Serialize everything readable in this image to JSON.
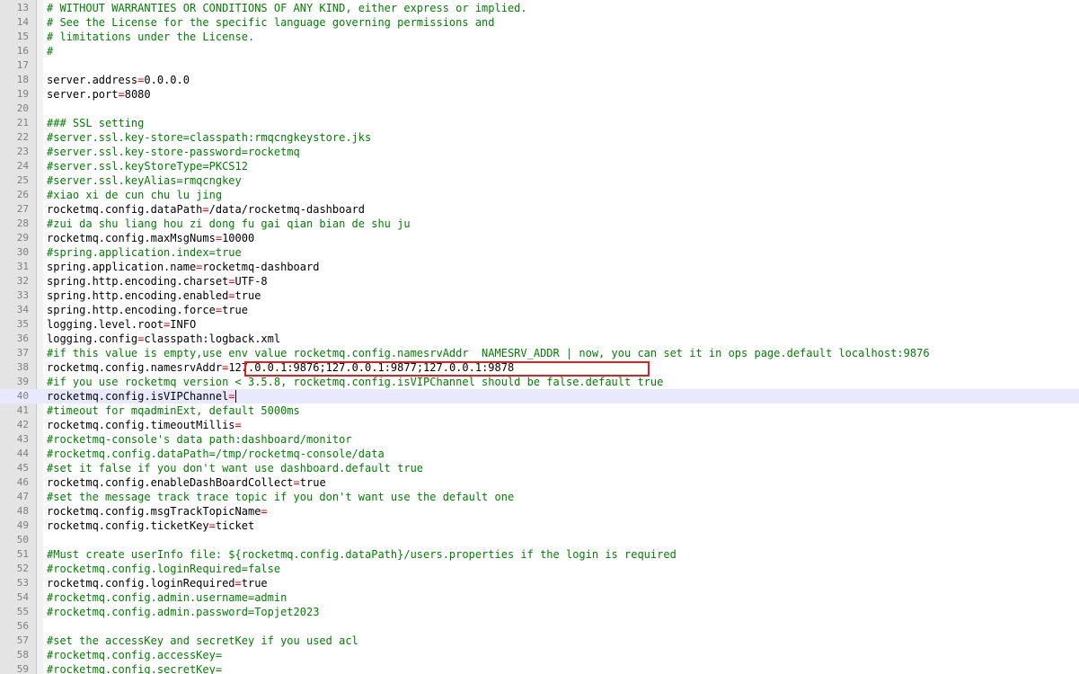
{
  "editor": {
    "current_line": 40,
    "lines": [
      {
        "n": "13",
        "type": "comment",
        "text": "# WITHOUT WARRANTIES OR CONDITIONS OF ANY KIND, either express or implied."
      },
      {
        "n": "14",
        "type": "comment",
        "text": "# See the License for the specific language governing permissions and"
      },
      {
        "n": "15",
        "type": "comment",
        "text": "# limitations under the License."
      },
      {
        "n": "16",
        "type": "comment",
        "text": "#"
      },
      {
        "n": "17",
        "type": "blank",
        "text": ""
      },
      {
        "n": "18",
        "type": "kv",
        "key": "server.address",
        "value": "0.0.0.0"
      },
      {
        "n": "19",
        "type": "kv",
        "key": "server.port",
        "value": "8080"
      },
      {
        "n": "20",
        "type": "blank",
        "text": ""
      },
      {
        "n": "21",
        "type": "comment",
        "text": "### SSL setting"
      },
      {
        "n": "22",
        "type": "comment",
        "text": "#server.ssl.key-store=classpath:rmqcngkeystore.jks"
      },
      {
        "n": "23",
        "type": "comment",
        "text": "#server.ssl.key-store-password=rocketmq"
      },
      {
        "n": "24",
        "type": "comment",
        "text": "#server.ssl.keyStoreType=PKCS12"
      },
      {
        "n": "25",
        "type": "comment",
        "text": "#server.ssl.keyAlias=rmqcngkey"
      },
      {
        "n": "26",
        "type": "comment",
        "text": "#xiao xi de cun chu lu jing"
      },
      {
        "n": "27",
        "type": "kv",
        "key": "rocketmq.config.dataPath",
        "value": "/data/rocketmq-dashboard"
      },
      {
        "n": "28",
        "type": "comment",
        "text": "#zui da shu liang hou zi dong fu gai qian bian de shu ju"
      },
      {
        "n": "29",
        "type": "kv",
        "key": "rocketmq.config.maxMsgNums",
        "value": "10000"
      },
      {
        "n": "30",
        "type": "comment",
        "text": "#spring.application.index=true"
      },
      {
        "n": "31",
        "type": "kv",
        "key": "spring.application.name",
        "value": "rocketmq-dashboard"
      },
      {
        "n": "32",
        "type": "kv",
        "key": "spring.http.encoding.charset",
        "value": "UTF-8"
      },
      {
        "n": "33",
        "type": "kv",
        "key": "spring.http.encoding.enabled",
        "value": "true"
      },
      {
        "n": "34",
        "type": "kv",
        "key": "spring.http.encoding.force",
        "value": "true"
      },
      {
        "n": "35",
        "type": "kv",
        "key": "logging.level.root",
        "value": "INFO"
      },
      {
        "n": "36",
        "type": "kv",
        "key": "logging.config",
        "value": "classpath:logback.xml"
      },
      {
        "n": "37",
        "type": "comment",
        "text": "#if this value is empty,use env value rocketmq.config.namesrvAddr  NAMESRV_ADDR | now, you can set it in ops page.default localhost:9876"
      },
      {
        "n": "38",
        "type": "kv",
        "key": "rocketmq.config.namesrvAddr",
        "value": "127.0.0.1:9876;127.0.0.1:9877;127.0.0.1:9878"
      },
      {
        "n": "39",
        "type": "comment",
        "text": "#if you use rocketmq version < 3.5.8, rocketmq.config.isVIPChannel should be false.default true"
      },
      {
        "n": "40",
        "type": "kv",
        "key": "rocketmq.config.isVIPChannel",
        "value": ""
      },
      {
        "n": "41",
        "type": "comment",
        "text": "#timeout for mqadminExt, default 5000ms"
      },
      {
        "n": "42",
        "type": "kv",
        "key": "rocketmq.config.timeoutMillis",
        "value": ""
      },
      {
        "n": "43",
        "type": "comment",
        "text": "#rocketmq-console's data path:dashboard/monitor"
      },
      {
        "n": "44",
        "type": "comment",
        "text": "#rocketmq.config.dataPath=/tmp/rocketmq-console/data"
      },
      {
        "n": "45",
        "type": "comment",
        "text": "#set it false if you don't want use dashboard.default true"
      },
      {
        "n": "46",
        "type": "kv",
        "key": "rocketmq.config.enableDashBoardCollect",
        "value": "true"
      },
      {
        "n": "47",
        "type": "comment",
        "text": "#set the message track trace topic if you don't want use the default one"
      },
      {
        "n": "48",
        "type": "kv",
        "key": "rocketmq.config.msgTrackTopicName",
        "value": ""
      },
      {
        "n": "49",
        "type": "kv",
        "key": "rocketmq.config.ticketKey",
        "value": "ticket"
      },
      {
        "n": "50",
        "type": "blank",
        "text": ""
      },
      {
        "n": "51",
        "type": "comment",
        "text": "#Must create userInfo file: ${rocketmq.config.dataPath}/users.properties if the login is required"
      },
      {
        "n": "52",
        "type": "comment",
        "text": "#rocketmq.config.loginRequired=false"
      },
      {
        "n": "53",
        "type": "kv",
        "key": "rocketmq.config.loginRequired",
        "value": "true"
      },
      {
        "n": "54",
        "type": "comment",
        "text": "#rocketmq.config.admin.username=admin"
      },
      {
        "n": "55",
        "type": "comment",
        "text": "#rocketmq.config.admin.password=Topjet2023"
      },
      {
        "n": "56",
        "type": "blank",
        "text": ""
      },
      {
        "n": "57",
        "type": "comment",
        "text": "#set the accessKey and secretKey if you used acl"
      },
      {
        "n": "58",
        "type": "comment",
        "text": "#rocketmq.config.accessKey="
      },
      {
        "n": "59",
        "type": "comment",
        "text": "#rocketmq.config.secretKey="
      }
    ],
    "operator": "=",
    "colors": {
      "comment": "#008000",
      "operator": "#ff0000",
      "text": "#000000",
      "line_number": "#808080",
      "gutter": "#e4e4e4",
      "current_line": "#e8e8ff",
      "highlight_box": "#e02020"
    }
  }
}
